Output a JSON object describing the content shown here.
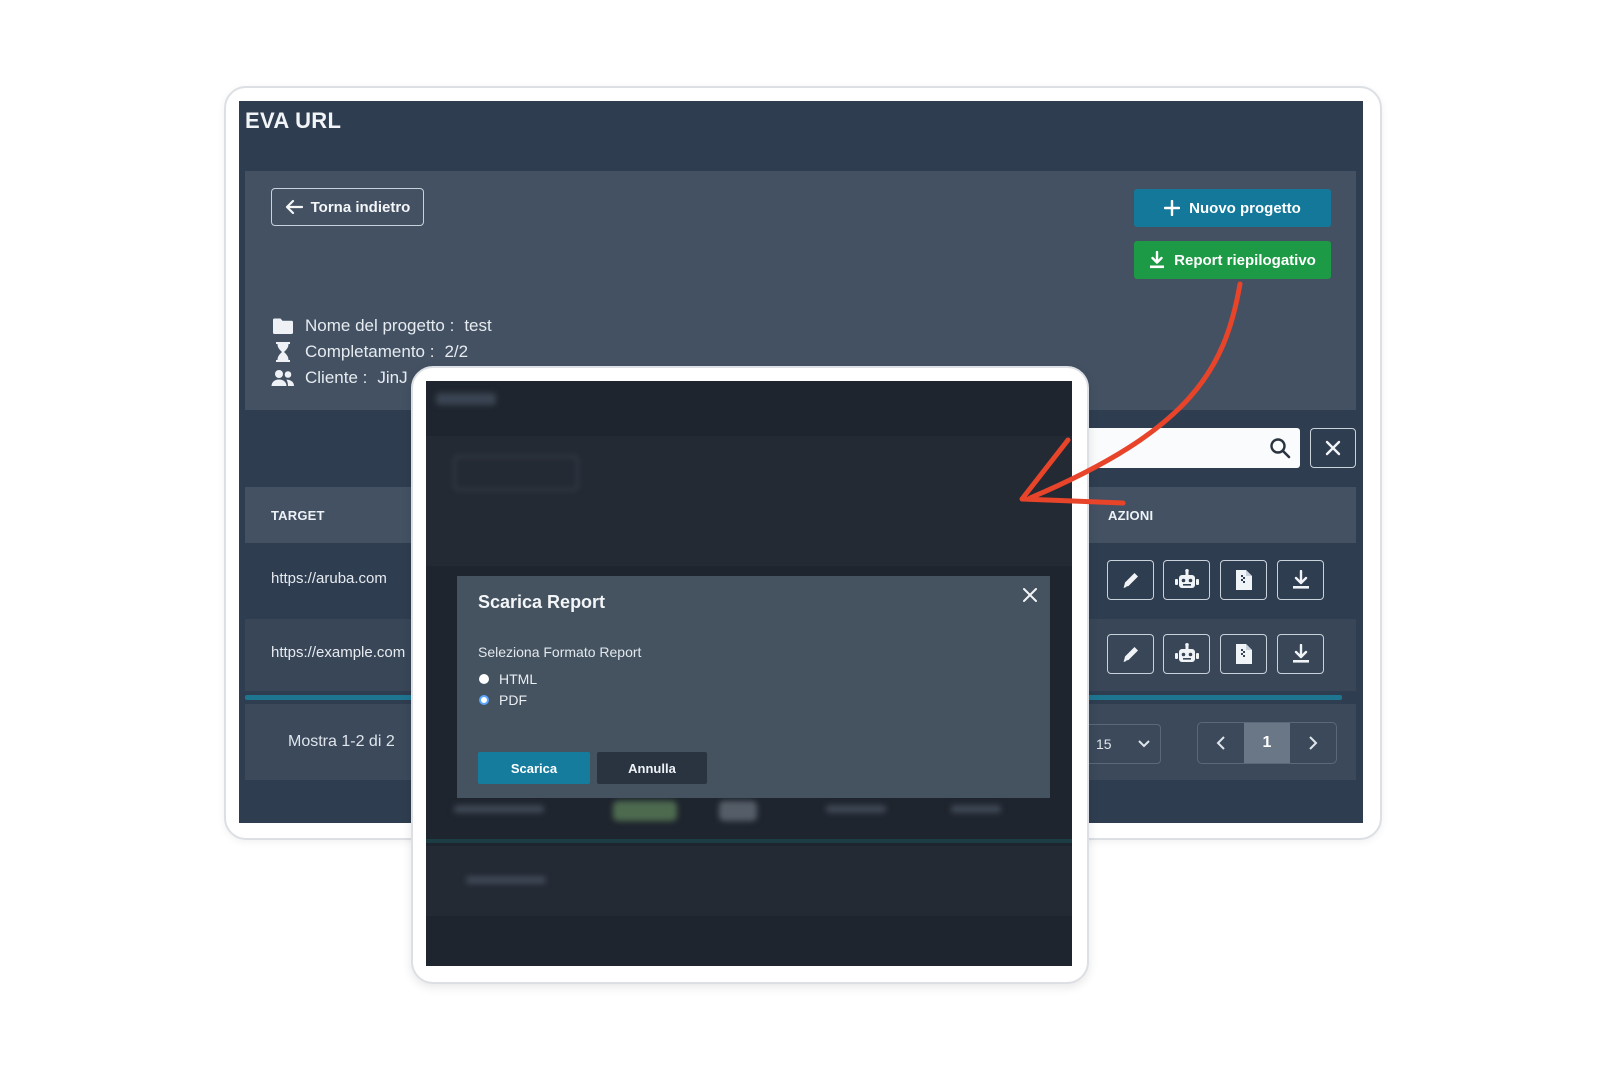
{
  "app": {
    "title": "EVA URL"
  },
  "toolbar": {
    "back_label": "Torna indietro",
    "new_project_label": "Nuovo progetto",
    "summary_report_label": "Report riepilogativo"
  },
  "project": {
    "name_label": "Nome del progetto :",
    "name_value": "test",
    "completion_label": "Completamento :",
    "completion_value": "2/2",
    "client_label": "Cliente :",
    "client_value": "JinJ"
  },
  "table": {
    "headers": {
      "target": "TARGET",
      "actions": "AZIONI"
    },
    "rows": [
      {
        "target": "https://aruba.com"
      },
      {
        "target": "https://example.com"
      }
    ]
  },
  "footer": {
    "showing": "Mostra 1-2 di 2",
    "per_page": "15",
    "current_page": "1"
  },
  "modal": {
    "title": "Scarica Report",
    "select_label": "Seleziona Formato Report",
    "options": [
      "HTML",
      "PDF"
    ],
    "selected": "PDF",
    "download_label": "Scarica",
    "cancel_label": "Annulla"
  },
  "colors": {
    "app_bg": "#2f3d50",
    "panel_bg": "#435163",
    "primary_blue": "#13789a",
    "success_green": "#1c9a45",
    "annotation_arrow": "#e8442a",
    "modal_bg": "#45525f"
  },
  "icons": [
    "arrow-left-icon",
    "plus-icon",
    "download-icon",
    "folder-icon",
    "hourglass-icon",
    "users-icon",
    "search-icon",
    "close-icon",
    "pencil-icon",
    "robot-icon",
    "document-icon",
    "chevron-down-icon",
    "chevron-left-icon",
    "chevron-right-icon"
  ]
}
